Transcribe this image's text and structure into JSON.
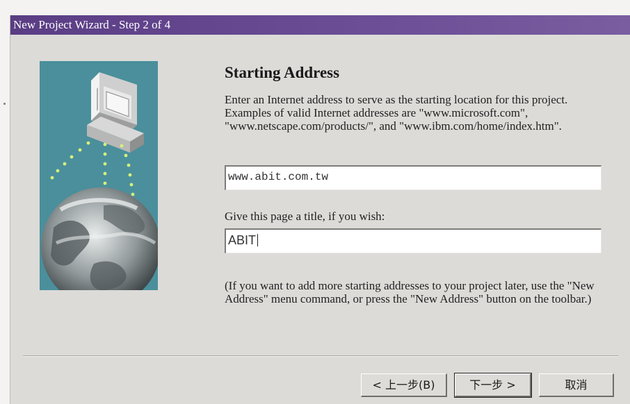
{
  "window": {
    "title": "New Project Wizard - Step 2 of 4"
  },
  "page": {
    "heading": "Starting Address",
    "description": "Enter an Internet address to serve as the starting location for this project.  Examples of valid Internet addresses are \"www.microsoft.com\", \"www.netscape.com/products/\", and \"www.ibm.com/home/index.htm\".",
    "address_value": "www.abit.com.tw",
    "title_label": "Give this page a title, if you wish:",
    "title_value": "ABIT",
    "note": "(If you want to add more starting addresses to your project later, use the \"New Address\" menu command, or press the \"New Address\" button on the toolbar.)"
  },
  "buttons": {
    "back": "< 上一步(B)",
    "next": "下一步 >",
    "cancel": "取消"
  },
  "illustration": {
    "icons": [
      "computer-icon",
      "earth-globe-icon"
    ],
    "background_color": "#4a8f9b"
  }
}
